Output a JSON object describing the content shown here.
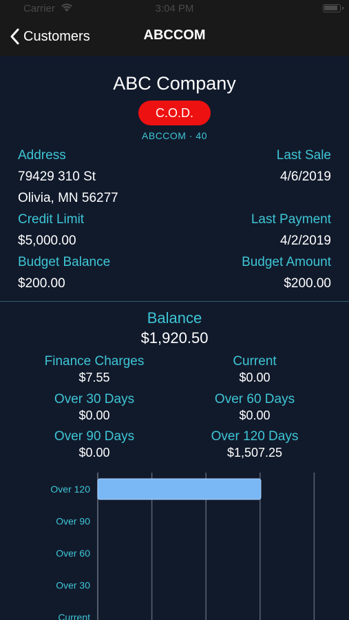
{
  "status": {
    "carrier": "Carrier",
    "time": "3:04 PM"
  },
  "nav": {
    "back_label": "Customers",
    "title": "ABCCOM"
  },
  "customer": {
    "name": "ABC Company",
    "badge": "C.O.D.",
    "code_line": "ABCCOM  ·  40",
    "address_label": "Address",
    "address_line1": "79429 310 St",
    "address_line2": "Olivia, MN 56277",
    "last_sale_label": "Last Sale",
    "last_sale": "4/6/2019",
    "credit_limit_label": "Credit Limit",
    "credit_limit": "$5,000.00",
    "last_payment_label": "Last Payment",
    "last_payment": "4/2/2019",
    "budget_balance_label": "Budget Balance",
    "budget_balance": "$200.00",
    "budget_amount_label": "Budget Amount",
    "budget_amount": "$200.00"
  },
  "balance": {
    "label": "Balance",
    "value": "$1,920.50",
    "finance_label": "Finance Charges",
    "finance": "$7.55",
    "current_label": "Current",
    "current": "$0.00",
    "over30_label": "Over 30 Days",
    "over30": "$0.00",
    "over60_label": "Over 60 Days",
    "over60": "$0.00",
    "over90_label": "Over 90 Days",
    "over90": "$0.00",
    "over120_label": "Over 120 Days",
    "over120": "$1,507.25"
  },
  "colors": {
    "accent": "#3ec6d6",
    "badge": "#ee1111",
    "bar": "#7ab8f5",
    "background": "#111a2b",
    "nav": "#191919"
  },
  "chart_data": {
    "type": "bar",
    "orientation": "horizontal",
    "categories": [
      "Over 120",
      "Over 90",
      "Over 60",
      "Over 30",
      "Current"
    ],
    "values": [
      1507.25,
      0,
      0,
      0,
      0
    ],
    "xlim": [
      0,
      2500
    ],
    "grid": true
  }
}
